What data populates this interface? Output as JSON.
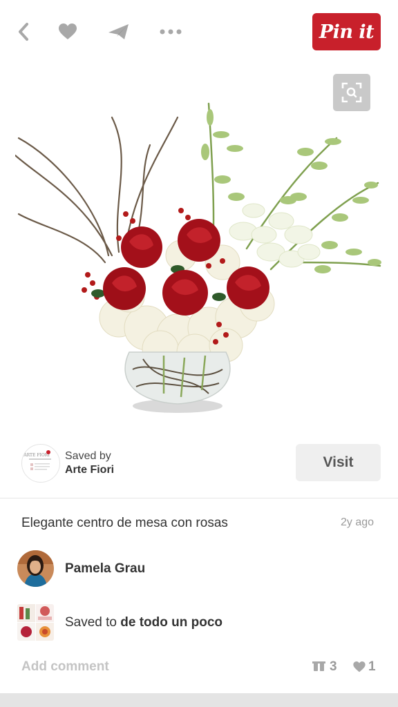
{
  "header": {
    "pinit_label": "Pin it",
    "icons": [
      "back-icon",
      "heart-icon",
      "send-icon",
      "more-icon"
    ],
    "brand_color": "#c8202b"
  },
  "pin": {
    "source_logo_text": "ARTE FIORI",
    "saved_by_label": "Saved by",
    "saved_by_name": "Arte Fiori",
    "visit_label": "Visit",
    "description": "Elegante centro de mesa con rosas",
    "timestamp": "2y ago"
  },
  "pinner": {
    "name": "Pamela Grau"
  },
  "board": {
    "prefix": "Saved to ",
    "name": "de todo un poco"
  },
  "footer": {
    "add_comment": "Add comment",
    "repins": "3",
    "likes": "1"
  }
}
